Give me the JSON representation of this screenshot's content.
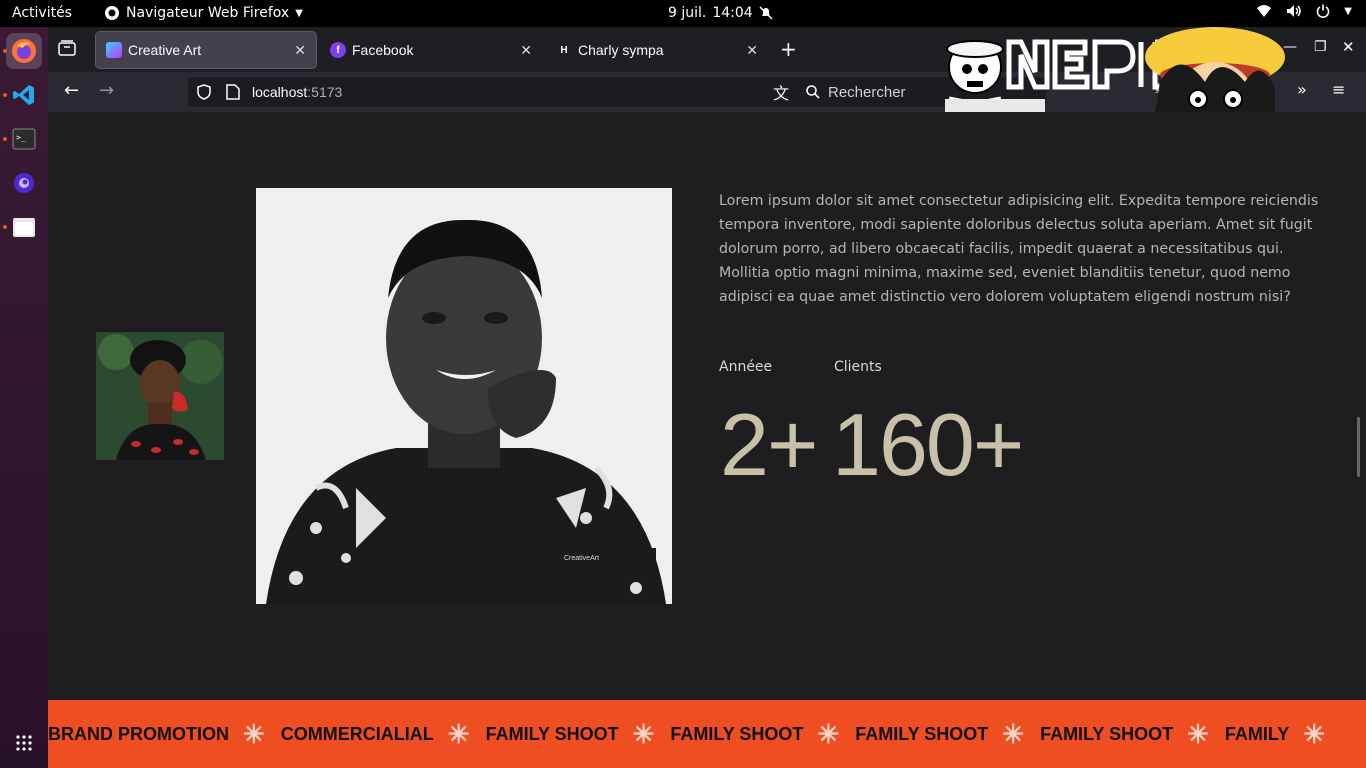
{
  "system": {
    "activities": "Activités",
    "app_menu": "Navigateur Web Firefox",
    "date": "9 juil.",
    "time": "14:04"
  },
  "browser": {
    "tabs": [
      {
        "label": "Creative Art",
        "active": true
      },
      {
        "label": "Facebook",
        "active": false
      },
      {
        "label": "Charly sympa",
        "active": false
      }
    ],
    "url_host": "localhost",
    "url_port": ":5173",
    "search_placeholder": "Rechercher"
  },
  "content": {
    "paragraph": "Lorem ipsum dolor sit amet consectetur adipisicing elit. Expedita tempore reiciendis tempora inventore, modi sapiente doloribus delectus soluta aperiam. Amet sit fugit dolorum porro, ad libero obcaecati facilis, impedit quaerat a necessitatibus qui. Mollitia optio magni minima, maxime sed, eveniet blanditiis tenetur, quod nemo adipisci ea quae amet distinctio vero dolorem voluptatem eligendi nostrum nisi?",
    "stats": [
      {
        "label": "Annéee",
        "value": "2+"
      },
      {
        "label": "Clients",
        "value": "160+"
      }
    ],
    "photo_watermark": "CreativeArt"
  },
  "banner": {
    "items": [
      "BRAND PROMOTION",
      "COMMERCIALIAL",
      "FAMILY SHOOT",
      "FAMILY SHOOT",
      "FAMILY SHOOT",
      "FAMILY SHOOT",
      "FAMILY"
    ],
    "star": "✳"
  },
  "colors": {
    "accent": "#ef4e23",
    "stat_number": "#c8c1a7",
    "background": "#1e1e20"
  }
}
